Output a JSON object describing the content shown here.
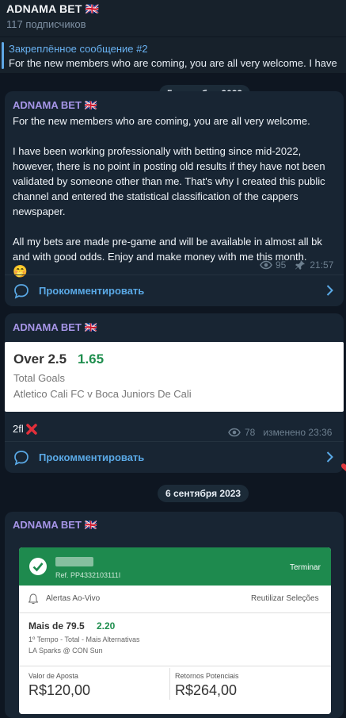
{
  "channel": {
    "name": "ADNAMA BET 🇬🇧",
    "subscribers": "117 подписчиков"
  },
  "pinned": {
    "title": "Закреплённое сообщение #2",
    "text": "For the new members who are coming, you are all very welcome.  I have"
  },
  "dates": {
    "first": "5 сентября 2023",
    "second": "6 сентября 2023"
  },
  "messages": [
    {
      "sender": "ADNAMA BET 🇬🇧",
      "paragraphs": [
        "For the new members who are coming, you are all very welcome.",
        "I have been working professionally with betting since mid-2022, however, there is no point in posting old results if they have not been validated by someone other than me. That's why I created this public channel and entered the statistical classification of the cappers newspaper.",
        "All my bets are made pre-game and will be available in almost all bk and with good odds. Enjoy and make money with me this month."
      ],
      "emoji": "🤭",
      "views": "95",
      "time": "21:57",
      "comment_label": "Прокомментировать"
    },
    {
      "sender": "ADNAMA BET 🇬🇧",
      "bet": {
        "selection": "Over 2.5",
        "odds": "1.65",
        "market": "Total Goals",
        "match": "Atletico Cali FC v Boca Juniors De Cali"
      },
      "caption": "2fl",
      "result_icon": "red-cross",
      "views": "78",
      "time": "изменено 23:36",
      "comment_label": "Прокомментировать"
    },
    {
      "sender": "ADNAMA BET 🇬🇧",
      "slip": {
        "ref": "Ref. PP4332103111I",
        "status": "Terminar",
        "alerts": "Alertas Ao-Vivo",
        "reuse": "Reutilizar Seleções",
        "selection": "Mais de 79.5",
        "odds": "2.20",
        "market": "1º Tempo - Total - Mais Alternativas",
        "match": "LA Sparks @ CON Sun",
        "stake_label": "Valor de Aposta",
        "stake": "R$120,00",
        "returns_label": "Retornos Potenciais",
        "returns": "R$264,00"
      }
    }
  ],
  "colors": {
    "background": "#0e1621",
    "bubble": "#182533",
    "sender": "#a695e7",
    "link": "#5aa9e6",
    "odds_green": "#1f8e4e",
    "slip_header": "#1e8a4e"
  }
}
